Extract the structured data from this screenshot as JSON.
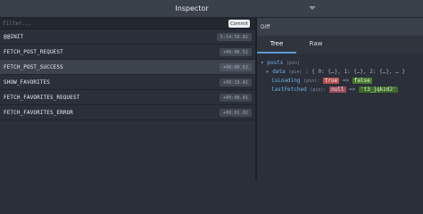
{
  "window": {
    "title": "Inspector"
  },
  "filter": {
    "placeholder": "filter...",
    "commit_label": "Commit"
  },
  "actions": [
    {
      "name": "@@INIT",
      "time": "5:14:50.02",
      "selected": false
    },
    {
      "name": "FETCH_POST_REQUEST",
      "time": "+00:00.52",
      "selected": false
    },
    {
      "name": "FETCH_POST_SUCCESS",
      "time": "+00:00.52",
      "selected": true
    },
    {
      "name": "SHOW_FAVORITES",
      "time": "+00:19.42",
      "selected": false
    },
    {
      "name": "FETCH_FAVORITES_REQUEST",
      "time": "+00:00.01",
      "selected": false
    },
    {
      "name": "FETCH_FAVORITES_ERROR",
      "time": "+00:01.02",
      "selected": false
    }
  ],
  "monitor": {
    "header": "Diff",
    "tabs": [
      "Tree",
      "Raw"
    ],
    "active_tab": "Tree"
  },
  "tree": {
    "root_key": "posts",
    "root_meta": "(pin)",
    "data_key": "data",
    "data_meta": "(pin)",
    "data_preview": ": { 0: {…}, 1: {…}, 2: {…}, … }",
    "isLoading_key": "isLoading",
    "isLoading_meta": "(pin):",
    "isLoading_old": "true",
    "isLoading_new": "false",
    "lastFetched_key": "lastFetched",
    "lastFetched_meta": "(pin):",
    "lastFetched_old": "null",
    "lastFetched_new": "'t3_jqkzd2'",
    "arrow": "=>"
  }
}
